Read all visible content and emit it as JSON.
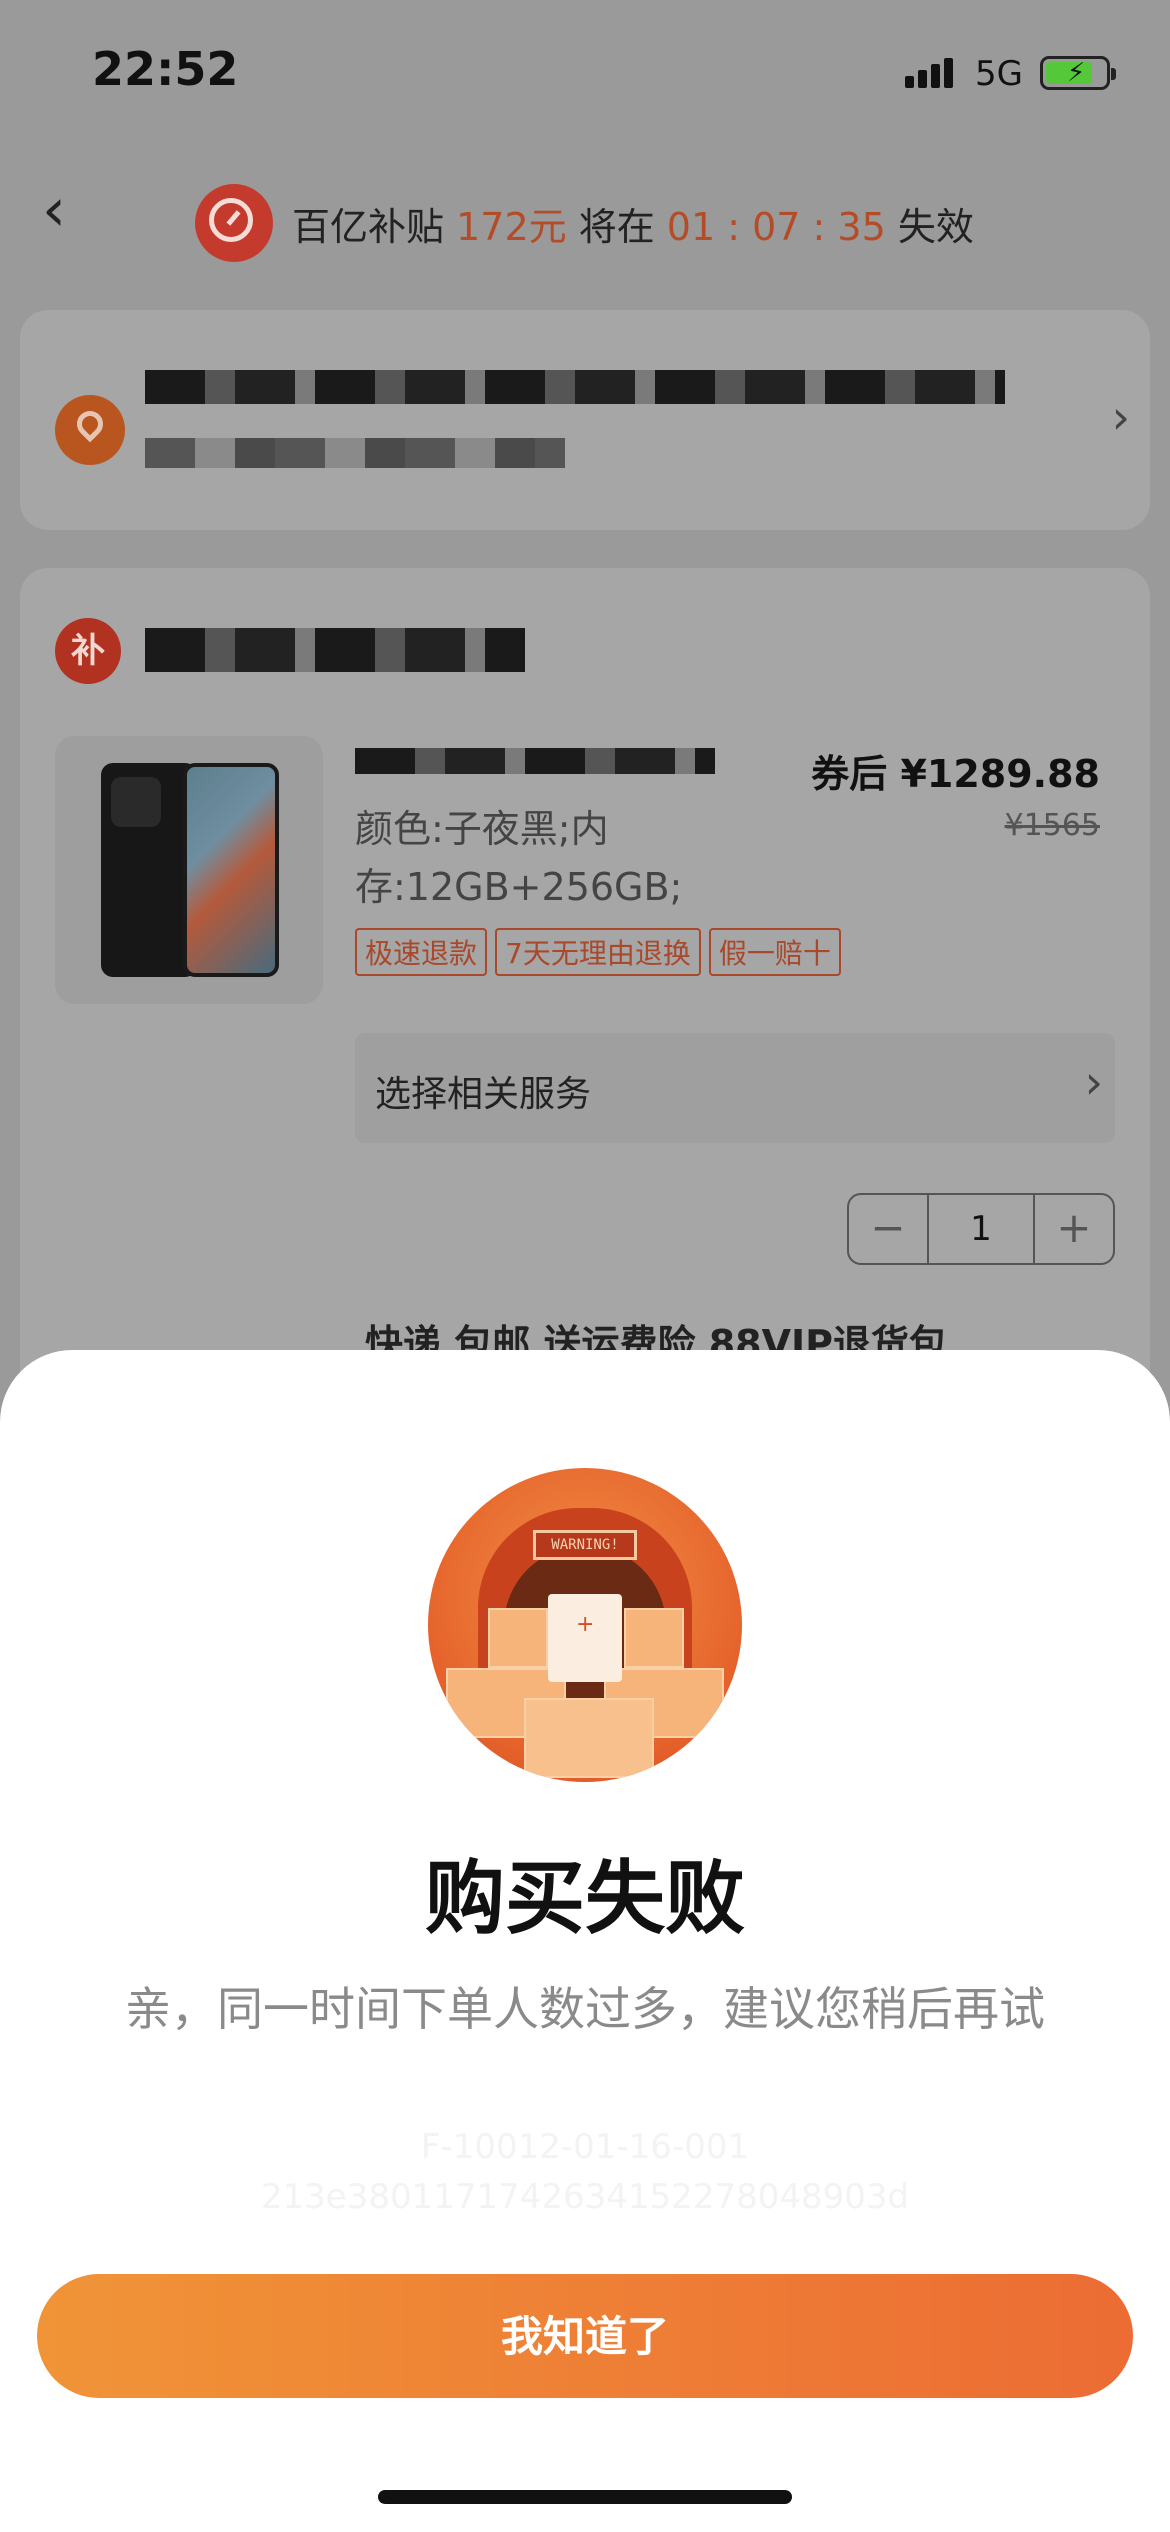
{
  "status_bar": {
    "time": "22:52",
    "network": "5G"
  },
  "header": {
    "prefix": "百亿补贴 ",
    "amount": "172元",
    "middle": " 将在 ",
    "countdown": "01 : 07 : 35",
    "suffix": " 失效"
  },
  "order": {
    "shop_badge": "补",
    "price_label": "券后 ",
    "price": "¥1289.88",
    "original_price": "¥1565",
    "spec": "颜色:子夜黑;内存:12GB+256GB;",
    "tags": [
      "极速退款",
      "7天无理由退换",
      "假一赔十"
    ],
    "service_label": "选择相关服务",
    "quantity": "1",
    "shipping_line": "快递 包邮 送运费险 88VIP退货包"
  },
  "dialog": {
    "illustration_sign": "WARNING!",
    "title": "购买失败",
    "message": "亲，同一时间下单人数过多，建议您稍后再试",
    "code_line1": "F-10012-01-16-001",
    "code_line2": "213e3801171742634152278048903d",
    "confirm_label": "我知道了"
  },
  "colors": {
    "accent": "#ec6c34",
    "button_start": "#f09437",
    "button_end": "#ec6c34"
  }
}
